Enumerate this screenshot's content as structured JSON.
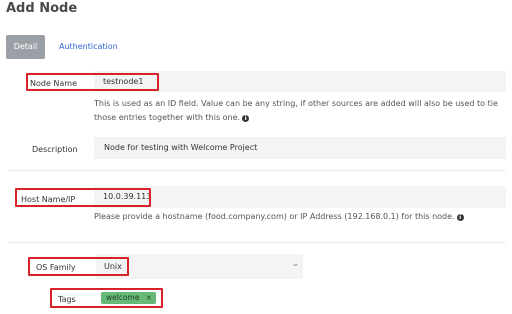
{
  "page": {
    "title": "Add Node"
  },
  "tabs": [
    {
      "label": "Detail",
      "active": true
    },
    {
      "label": "Authentication",
      "active": false
    }
  ],
  "form": {
    "node_name": {
      "label": "Node Name",
      "value": "testnode1",
      "help": "This is used as an ID field. Value can be any string, if other sources are added will also be used to tie those entries together with this one."
    },
    "description": {
      "label": "Description",
      "value": "Node for testing with Welcome Project"
    },
    "host_name": {
      "label": "Host Name/IP",
      "value": "10.0.39.113",
      "help": "Please provide a hostname (food.company.com) or IP Address (192.168.0.1) for this node."
    },
    "os_family": {
      "label": "OS Family",
      "selected": "Unix"
    },
    "tags": {
      "label": "Tags",
      "items": [
        "welcome"
      ]
    }
  },
  "colors": {
    "annotation_box": "#d8222a",
    "tag_bg": "#67b978",
    "link": "#3367d6",
    "active_tab": "#9aa0a6"
  },
  "icons": [
    "info-icon",
    "chevron-down-icon",
    "close-icon"
  ]
}
